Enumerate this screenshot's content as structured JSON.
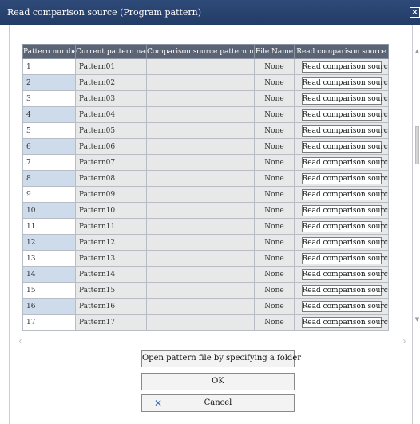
{
  "window": {
    "title": "Read comparison source (Program pattern)",
    "close_icon": "close-icon"
  },
  "table": {
    "headers": [
      "Pattern number",
      "Current pattern name",
      "Comparison source pattern name",
      "File Name",
      "Read comparison source"
    ],
    "rows": [
      {
        "number": "1",
        "current": "Pattern01",
        "source": "",
        "file": "None",
        "action": "Read comparison source"
      },
      {
        "number": "2",
        "current": "Pattern02",
        "source": "",
        "file": "None",
        "action": "Read comparison source"
      },
      {
        "number": "3",
        "current": "Pattern03",
        "source": "",
        "file": "None",
        "action": "Read comparison source"
      },
      {
        "number": "4",
        "current": "Pattern04",
        "source": "",
        "file": "None",
        "action": "Read comparison source"
      },
      {
        "number": "5",
        "current": "Pattern05",
        "source": "",
        "file": "None",
        "action": "Read comparison source"
      },
      {
        "number": "6",
        "current": "Pattern06",
        "source": "",
        "file": "None",
        "action": "Read comparison source"
      },
      {
        "number": "7",
        "current": "Pattern07",
        "source": "",
        "file": "None",
        "action": "Read comparison source"
      },
      {
        "number": "8",
        "current": "Pattern08",
        "source": "",
        "file": "None",
        "action": "Read comparison source"
      },
      {
        "number": "9",
        "current": "Pattern09",
        "source": "",
        "file": "None",
        "action": "Read comparison source"
      },
      {
        "number": "10",
        "current": "Pattern10",
        "source": "",
        "file": "None",
        "action": "Read comparison source"
      },
      {
        "number": "11",
        "current": "Pattern11",
        "source": "",
        "file": "None",
        "action": "Read comparison source"
      },
      {
        "number": "12",
        "current": "Pattern12",
        "source": "",
        "file": "None",
        "action": "Read comparison source"
      },
      {
        "number": "13",
        "current": "Pattern13",
        "source": "",
        "file": "None",
        "action": "Read comparison source"
      },
      {
        "number": "14",
        "current": "Pattern14",
        "source": "",
        "file": "None",
        "action": "Read comparison source"
      },
      {
        "number": "15",
        "current": "Pattern15",
        "source": "",
        "file": "None",
        "action": "Read comparison source"
      },
      {
        "number": "16",
        "current": "Pattern16",
        "source": "",
        "file": "None",
        "action": "Read comparison source"
      },
      {
        "number": "17",
        "current": "Pattern17",
        "source": "",
        "file": "None",
        "action": "Read comparison source"
      }
    ]
  },
  "buttons": {
    "open_folder": "Open pattern file by specifying a folder",
    "ok": "OK",
    "cancel": "Cancel",
    "cancel_icon": "x-icon"
  },
  "scroll": {
    "left_arrow": "‹",
    "right_arrow": "›",
    "up_arrow": "▲",
    "down_arrow": "▼"
  },
  "colors": {
    "titlebar": "#2b4572",
    "header": "#5a6474",
    "row_highlight": "#cddbea",
    "cancel_icon": "#2f6fb8"
  }
}
